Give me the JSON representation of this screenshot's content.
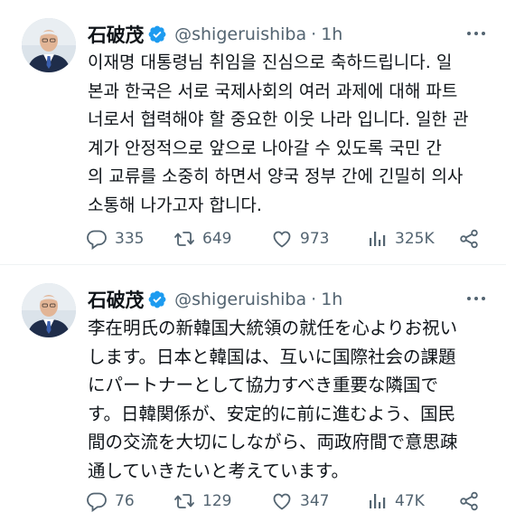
{
  "tweets": [
    {
      "author_name": "石破茂",
      "handle": "@shigeruishiba",
      "separator": "·",
      "time": "1h",
      "text": "이재명 대통령님 취임을 진심으로 축하드립니다. 일\n본과 한국은 서로 국제사회의 여러 과제에 대해 파트\n너로서 협력해야 할 중요한 이웃 나라 입니다. 일한 관\n계가 안정적으로 앞으로 나아갈 수 있도록 국민 간\n의 교류를 소중히 하면서 양국 정부 간에 긴밀히 의사\n소통해 나가고자 합니다.",
      "replies": "335",
      "reposts": "649",
      "likes": "973",
      "views": "325K"
    },
    {
      "author_name": "石破茂",
      "handle": "@shigeruishiba",
      "separator": "·",
      "time": "1h",
      "text": "李在明氏の新韓国大統領の就任を心よりお祝い\nします。日本と韓国は、互いに国際社会の課題\nにパートナーとして協力すべき重要な隣国で\nす。日韓関係が、安定的に前に進むよう、国民\n間の交流を大切にしながら、両政府間で意思疎\n通していきたいと考えています。",
      "replies": "76",
      "reposts": "129",
      "likes": "347",
      "views": "47K"
    }
  ],
  "icons": {
    "verified": "verified-badge-icon",
    "more": "more-options-icon",
    "reply": "reply-icon",
    "repost": "repost-icon",
    "like": "like-icon",
    "views": "views-icon",
    "share": "share-icon"
  },
  "colors": {
    "verified_blue": "#1d9bf0",
    "secondary_text": "#536471",
    "primary_text": "#0f1419"
  }
}
